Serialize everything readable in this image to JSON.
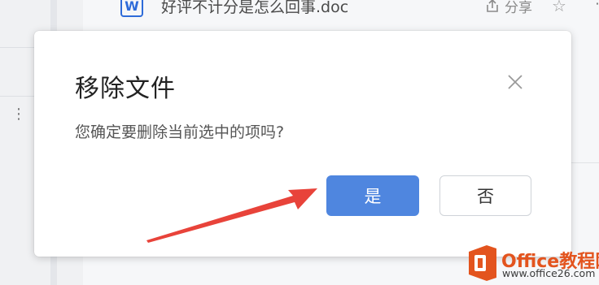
{
  "background": {
    "file_name": "好评不计分是怎么回事.doc",
    "file_icon_letter": "W",
    "share_label": "分享",
    "star_icon": "star-icon",
    "more_icon": "more-vertical-icon"
  },
  "dialog": {
    "title": "移除文件",
    "message": "您确定要删除当前选中的项吗?",
    "confirm_label": "是",
    "cancel_label": "否",
    "close_icon": "close-icon",
    "colors": {
      "confirm_bg": "#4f86df",
      "annotation_arrow": "#e8433a"
    }
  },
  "watermark": {
    "title": "Office教程网",
    "url": "www.office26.com"
  }
}
